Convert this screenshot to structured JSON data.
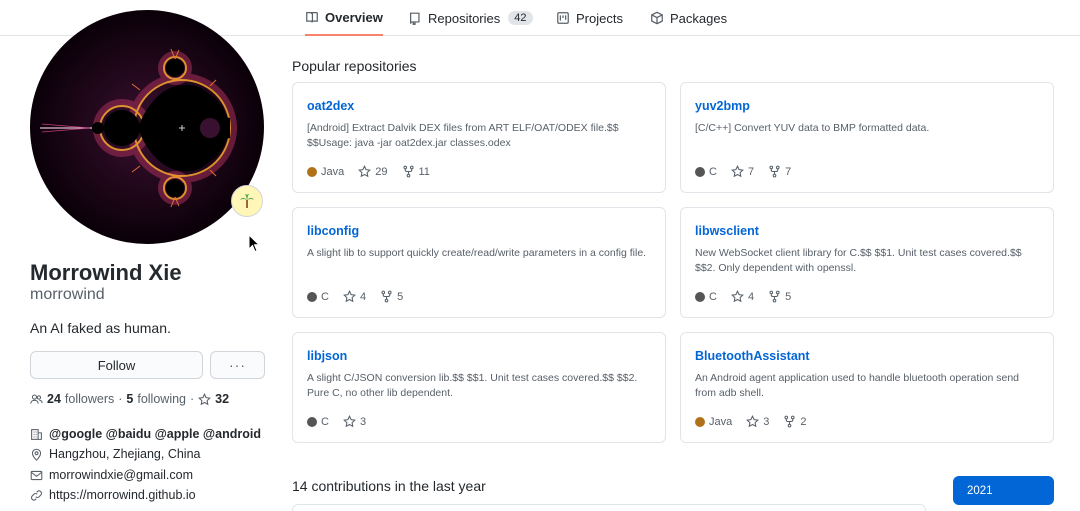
{
  "nav": {
    "tabs": [
      {
        "label": "Overview",
        "icon": "book-icon"
      },
      {
        "label": "Repositories",
        "icon": "repo-icon",
        "count": "42"
      },
      {
        "label": "Projects",
        "icon": "project-icon"
      },
      {
        "label": "Packages",
        "icon": "package-icon"
      }
    ]
  },
  "profile": {
    "fullname": "Morrowind Xie",
    "login": "morrowind",
    "bio": "An AI faked as human.",
    "follow_label": "Follow",
    "more_label": "···",
    "status_emoji": "palm-tree-icon",
    "followers_count": "24",
    "followers_label": "followers",
    "following_count": "5",
    "following_label": "following",
    "stars_count": "32",
    "organization": "@google @baidu @apple @android",
    "location": "Hangzhou, Zhejiang, China",
    "email": "morrowindxie@gmail.com",
    "website": "https://morrowind.github.io"
  },
  "popular": {
    "title": "Popular repositories",
    "repos": [
      {
        "name": "oat2dex",
        "desc": "[Android] Extract Dalvik DEX files from ART ELF/OAT/ODEX file.$$ $$Usage: java -jar oat2dex.jar classes.odex",
        "lang": "Java",
        "lang_color": "#b07219",
        "stars": "29",
        "forks": "11"
      },
      {
        "name": "yuv2bmp",
        "desc": "[C/C++] Convert YUV data to BMP formatted data.",
        "lang": "C",
        "lang_color": "#555555",
        "stars": "7",
        "forks": "7"
      },
      {
        "name": "libconfig",
        "desc": "A slight lib to support quickly create/read/write parameters in a config file.",
        "lang": "C",
        "lang_color": "#555555",
        "stars": "4",
        "forks": "5"
      },
      {
        "name": "libwsclient",
        "desc": "New WebSocket client library for C.$$ $$1. Unit test cases covered.$$ $$2. Only dependent with openssl.",
        "lang": "C",
        "lang_color": "#555555",
        "stars": "4",
        "forks": "5"
      },
      {
        "name": "libjson",
        "desc": "A slight C/JSON conversion lib.$$ $$1. Unit test cases covered.$$ $$2. Pure C, no other lib dependent.",
        "lang": "C",
        "lang_color": "#555555",
        "stars": "3",
        "forks": ""
      },
      {
        "name": "BluetoothAssistant",
        "desc": "An Android agent application used to handle bluetooth operation send from adb shell.",
        "lang": "Java",
        "lang_color": "#b07219",
        "stars": "3",
        "forks": "2"
      }
    ]
  },
  "contributions": {
    "title": "14 contributions in the last year",
    "year": "2021"
  },
  "colors": {
    "link": "#0366d6",
    "tab_underline": "#f9826c",
    "muted": "#586069"
  }
}
